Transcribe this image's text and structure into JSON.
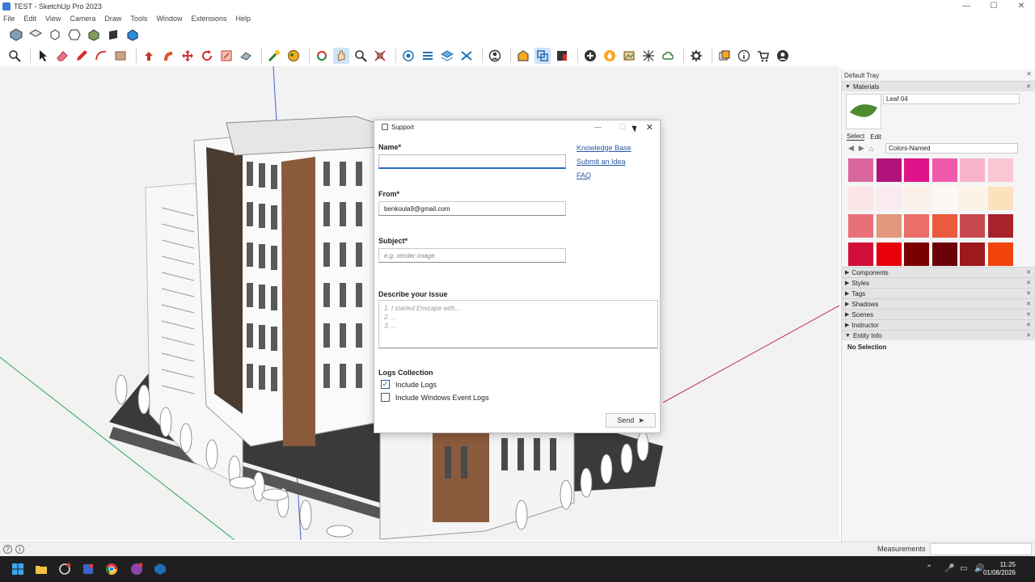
{
  "window": {
    "title": "TEST - SketchUp Pro 2023",
    "controls": [
      "—",
      "☐",
      "✕"
    ]
  },
  "menu": [
    "File",
    "Edit",
    "View",
    "Camera",
    "Draw",
    "Tools",
    "Window",
    "Extensions",
    "Help"
  ],
  "toolbar_top": [
    "iso-view-icon",
    "top-view-icon",
    "front-view-icon",
    "right-view-icon",
    "back-view-icon",
    "left-view-icon",
    "bottom-view-icon"
  ],
  "toolbar_main": [
    "search-icon",
    "select-icon",
    "eraser-icon",
    "pencil-icon",
    "arc-icon",
    "rectangle-icon",
    "push-pull-icon",
    "follow-me-icon",
    "move-icon",
    "rotate-icon",
    "scale-icon",
    "offset-icon",
    "tape-measure-icon",
    "paint-bucket-icon",
    "orbit-icon",
    "pan-icon",
    "zoom-icon",
    "zoom-extents-icon",
    "section-icon",
    "warehouse-icon",
    "extension-icon",
    "account-icon"
  ],
  "dialog": {
    "title": "Support",
    "name_label": "Name*",
    "name_value": "",
    "from_label": "From*",
    "from_value": "benkoula9@gmail.com",
    "subject_label": "Subject*",
    "subject_placeholder": "e.g. render image",
    "describe_label": "Describe your issue",
    "describe_placeholder": "1. I started Enscape with...\n2. ...\n3. ...",
    "logs_label": "Logs Collection",
    "include_logs_label": "Include Logs",
    "include_logs_checked": true,
    "include_event_logs_label": "Include Windows Event Logs",
    "include_event_logs_checked": false,
    "links": [
      "Knowledge Base",
      "Submit an Idea",
      "FAQ"
    ],
    "send_label": "Send"
  },
  "tray": {
    "title": "Default Tray",
    "materials_header": "Materials",
    "material_name": "Leaf 04",
    "tab_select": "Select",
    "tab_edit": "Edit",
    "library": "Colors-Named",
    "swatch_colors": [
      "#d9679e",
      "#b3127a",
      "#e0148a",
      "#ef5aac",
      "#f6b3c9",
      "#f9c6d4",
      "#fbe5e6",
      "#fbeaf0",
      "#fbf0e8",
      "#fef8f4",
      "#fdf2e6",
      "#fde1bd",
      "#e8707a",
      "#e0977a",
      "#ea6f6b",
      "#eb5a3d",
      "#c6484f",
      "#a7232c",
      "#cf0f38",
      "#e8000b",
      "#7a0000",
      "#6a0008",
      "#9c1a1d",
      "#f1430c"
    ],
    "panels": [
      "Components",
      "Styles",
      "Tags",
      "Shadows",
      "Scenes",
      "Instructor",
      "Entity Info"
    ],
    "entity_info": "No Selection"
  },
  "status": {
    "measurements_label": "Measurements"
  },
  "taskbar": {
    "time": "11:25",
    "date": "01/08/2026"
  }
}
